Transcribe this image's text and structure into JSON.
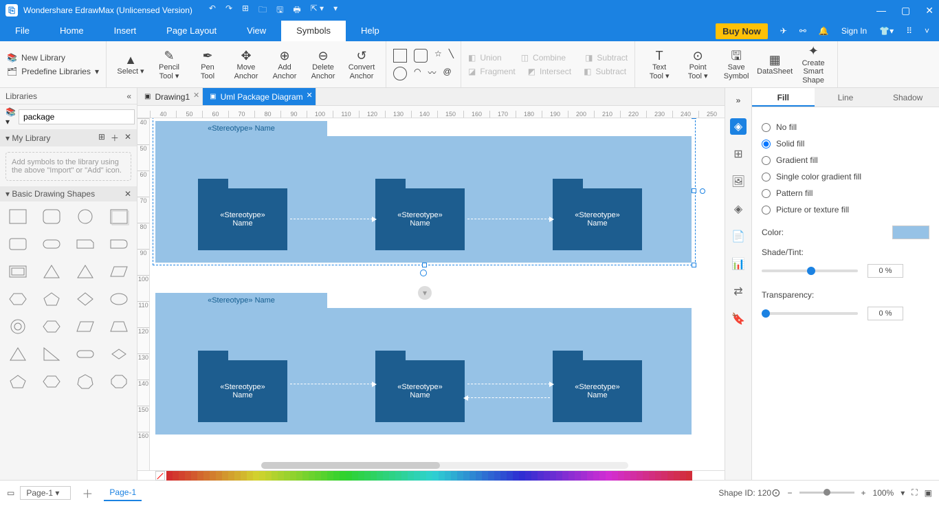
{
  "titlebar": {
    "app": "Wondershare EdrawMax (Unlicensed Version)"
  },
  "menus": [
    "File",
    "Home",
    "Insert",
    "Page Layout",
    "View",
    "Symbols",
    "Help"
  ],
  "active_menu": "Symbols",
  "right_header": {
    "buy": "Buy Now",
    "signin": "Sign In"
  },
  "ribbon": {
    "newlib": "New Library",
    "predef": "Predefine Libraries",
    "tools": [
      "Select",
      "Pencil Tool",
      "Pen Tool",
      "Move Anchor",
      "Add Anchor",
      "Delete Anchor",
      "Convert Anchor"
    ],
    "bool": [
      "Union",
      "Combine",
      "Subtract",
      "Fragment",
      "Intersect",
      "Subtract"
    ],
    "right": [
      "Text Tool",
      "Point Tool",
      "Save Symbol",
      "DataSheet",
      "Create Smart Shape"
    ]
  },
  "left": {
    "title": "Libraries",
    "search": "package",
    "mylib": "My Library",
    "hint": "Add symbols to the library using the above \"Import\" or \"Add\" icon.",
    "basic": "Basic Drawing Shapes"
  },
  "tabs": [
    {
      "label": "Drawing1",
      "active": false
    },
    {
      "label": "Uml Package Diagram",
      "active": true
    }
  ],
  "canvas": {
    "outer_tab": "«Stereotype» Name",
    "inner_label1": "«Stereotype»",
    "inner_label2": "Name"
  },
  "rp": {
    "tabs": [
      "Fill",
      "Line",
      "Shadow"
    ],
    "opts": [
      "No fill",
      "Solid fill",
      "Gradient fill",
      "Single color gradient fill",
      "Pattern fill",
      "Picture or texture fill"
    ],
    "sel": "Solid fill",
    "color": "Color:",
    "shade": "Shade/Tint:",
    "trans": "Transparency:",
    "pct": "0 %"
  },
  "status": {
    "page_sel": "Page-1",
    "page_tab": "Page-1",
    "shapeid": "Shape ID: 120",
    "zoom": "100%"
  },
  "ruler_h": [
    "40",
    "50",
    "60",
    "70",
    "80",
    "90",
    "100",
    "110",
    "120",
    "130",
    "140",
    "150",
    "160",
    "170",
    "180",
    "190",
    "200",
    "210",
    "220",
    "230",
    "240",
    "250"
  ],
  "ruler_v": [
    "40",
    "50",
    "60",
    "70",
    "80",
    "90",
    "100",
    "110",
    "120",
    "130",
    "140",
    "150",
    "160"
  ]
}
